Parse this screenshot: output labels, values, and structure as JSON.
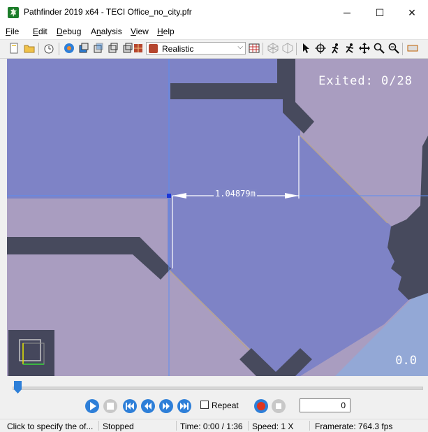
{
  "window": {
    "title": "Pathfinder 2019 x64 - TECI Office_no_city.pfr",
    "minimize_glyph": "─",
    "maximize_glyph": "☐",
    "close_glyph": "✕"
  },
  "menu": {
    "items": [
      {
        "label": "File",
        "accel": "F",
        "rest": "ile"
      },
      {
        "label": "Edit",
        "accel": "E",
        "rest": "dit"
      },
      {
        "label": "Debug",
        "accel": "D",
        "rest": "ebug"
      },
      {
        "label": "Analysis",
        "accel": "n",
        "pre": "A",
        "rest": "alysis"
      },
      {
        "label": "View",
        "accel": "V",
        "rest": "iew"
      },
      {
        "label": "Help",
        "accel": "H",
        "rest": "elp"
      }
    ]
  },
  "toolbar": {
    "render_mode": "Realistic",
    "icons": [
      "new-file-icon",
      "open-folder-icon",
      "timer-icon",
      "view-perspective-icon",
      "view-top-icon",
      "view-front-icon",
      "view-side-icon",
      "view-iso-icon",
      "render-mode-icon",
      "table-icon",
      "wireframe-icon",
      "wireframe-alt-icon",
      "select-pointer-icon",
      "orbit-icon",
      "walk-icon",
      "run-icon",
      "pan-icon",
      "zoom-icon",
      "zoom-extents-icon",
      "more-icon"
    ]
  },
  "viewport": {
    "exited_label": "Exited:  0/28",
    "dimension_label": "1.04879m",
    "corner_readout": "0.0",
    "colors": {
      "room_fill": "#7e83c6",
      "outside_fill": "#a99dc0",
      "wall_fill": "#474a5d",
      "edge_line": "#b7a48f",
      "guide_line": "#5b8df2",
      "blue_area": "#93a8d6"
    }
  },
  "playback": {
    "repeat_label": "Repeat",
    "frame_value": "0",
    "colors": {
      "blue": "#2e7fd8",
      "gray": "#c8c8c8",
      "red": "#e0351f"
    }
  },
  "status": {
    "hint": "Click to specify the of...",
    "state": "Stopped",
    "time": "Time: 0:00 / 1:36",
    "speed": "Speed: 1 X",
    "framerate": "Framerate: 764.3 fps"
  }
}
